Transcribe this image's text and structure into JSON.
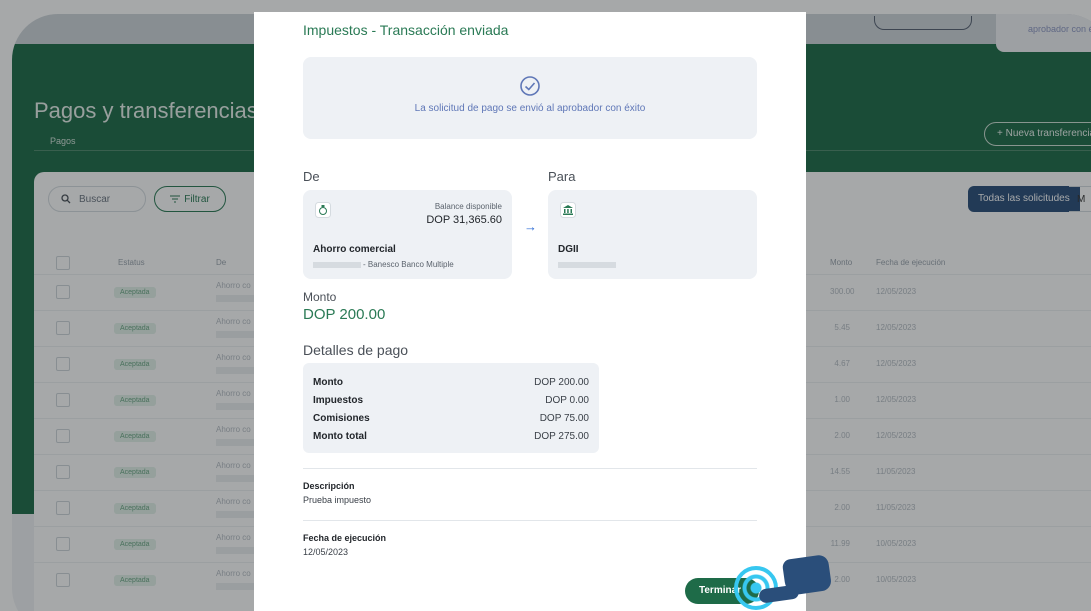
{
  "background": {
    "top_card_text": "aprobador con éx",
    "page_title": "Pagos y transferencias",
    "tab_pagos": "Pagos",
    "new_transfer_label": "+ Nueva transferencia",
    "search_placeholder": "Buscar",
    "filter_label": "Filtrar",
    "todas_label": "Todas las solicitudes",
    "m_label": "M",
    "columns": {
      "estatus": "Estatus",
      "de": "De",
      "monto": "Monto",
      "fecha": "Fecha de ejecución"
    },
    "rows": [
      {
        "status": "Aceptada",
        "de": "Ahorro co",
        "monto": "300.00",
        "fecha": "12/05/2023"
      },
      {
        "status": "Aceptada",
        "de": "Ahorro co",
        "monto": "5.45",
        "fecha": "12/05/2023"
      },
      {
        "status": "Aceptada",
        "de": "Ahorro co",
        "monto": "4.67",
        "fecha": "12/05/2023"
      },
      {
        "status": "Aceptada",
        "de": "Ahorro co",
        "monto": "1.00",
        "fecha": "12/05/2023"
      },
      {
        "status": "Aceptada",
        "de": "Ahorro co",
        "monto": "2.00",
        "fecha": "12/05/2023"
      },
      {
        "status": "Aceptada",
        "de": "Ahorro co",
        "monto": "14.55",
        "fecha": "11/05/2023"
      },
      {
        "status": "Aceptada",
        "de": "Ahorro co",
        "monto": "2.00",
        "fecha": "11/05/2023"
      },
      {
        "status": "Aceptada",
        "de": "Ahorro co",
        "monto": "11.99",
        "fecha": "10/05/2023"
      },
      {
        "status": "Aceptada",
        "de": "Ahorro co",
        "monto": "2.00",
        "fecha": "10/05/2023"
      }
    ]
  },
  "modal": {
    "title": "Impuestos - Transacción enviada",
    "success_message": "La solicitud de pago se envió al aprobador con éxito",
    "from_label": "De",
    "to_label": "Para",
    "from_card": {
      "balance_label": "Balance disponible",
      "balance_value": "DOP 31,365.60",
      "account_name": "Ahorro comercial",
      "bank": "- Banesco Banco Multiple",
      "icon": "piggy-bank-icon"
    },
    "to_card": {
      "name": "DGII",
      "icon": "bank-building-icon"
    },
    "amount_label": "Monto",
    "amount_value": "DOP 200.00",
    "details_label": "Detalles de pago",
    "details": [
      {
        "key": "Monto",
        "value": "DOP 200.00"
      },
      {
        "key": "Impuestos",
        "value": "DOP 0.00"
      },
      {
        "key": "Comisiones",
        "value": "DOP 75.00"
      },
      {
        "key": "Monto total",
        "value": "DOP 275.00"
      }
    ],
    "description_label": "Descripción",
    "description_value": "Prueba impuesto",
    "date_label": "Fecha de ejecución",
    "date_value": "12/05/2023",
    "finish_button": "Terminar"
  },
  "colors": {
    "brand_green": "#1e6b48",
    "accent_blue": "#2a4e7a",
    "highlight_cyan": "#37c7f0"
  }
}
